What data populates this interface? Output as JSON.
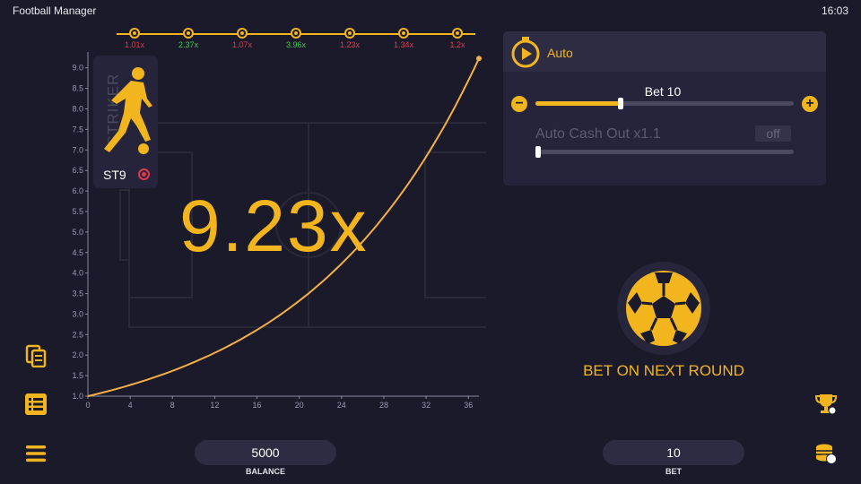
{
  "status_bar": {
    "app_title": "Football Manager",
    "time": "16:03"
  },
  "history": [
    {
      "value": "1.01x",
      "color": "#e0394f"
    },
    {
      "value": "2.37x",
      "color": "#3bc94b"
    },
    {
      "value": "1.07x",
      "color": "#e0394f"
    },
    {
      "value": "3.96x",
      "color": "#3bc94b"
    },
    {
      "value": "1.23x",
      "color": "#e0394f"
    },
    {
      "value": "1.34x",
      "color": "#e0394f"
    },
    {
      "value": "1.2x",
      "color": "#e0394f"
    }
  ],
  "chart_data": {
    "type": "line",
    "x_ticks": [
      "0",
      "4",
      "8",
      "12",
      "16",
      "20",
      "24",
      "28",
      "32",
      "36"
    ],
    "y_ticks": [
      "1.0",
      "1.5",
      "2.0",
      "2.5",
      "3.0",
      "3.5",
      "4.0",
      "4.5",
      "5.0",
      "5.5",
      "6.0",
      "6.5",
      "7.0",
      "7.5",
      "8.0",
      "8.5",
      "9.0"
    ],
    "xlim": [
      0,
      37
    ],
    "ylim": [
      1.0,
      9.3
    ],
    "x": [
      0,
      4,
      8,
      12,
      16,
      20,
      24,
      28,
      32,
      36,
      37
    ],
    "y": [
      1.0,
      1.26,
      1.6,
      2.05,
      2.6,
      3.3,
      4.2,
      5.35,
      6.8,
      8.65,
      9.23
    ],
    "line_color": "#f5b042"
  },
  "player": {
    "position_label": "STRIKER",
    "code": "ST9"
  },
  "current_multiplier": "9.23x",
  "auto_panel": {
    "title": "Auto",
    "bet_label": "Bet 10",
    "minus_label": "−",
    "plus_label": "+",
    "bet_slider_fraction": 0.33,
    "cash_out_label": "Auto Cash Out x1.1",
    "cash_out_toggle": "off",
    "cash_out_slider_fraction": 0.0
  },
  "bet_button_label": "BET ON NEXT ROUND",
  "balance": {
    "value": "5000",
    "label": "BALANCE"
  },
  "bet": {
    "value": "10",
    "label": "BET"
  },
  "colors": {
    "accent": "#f3b51d",
    "background": "#1b1a2b",
    "panel": "#25243a"
  }
}
